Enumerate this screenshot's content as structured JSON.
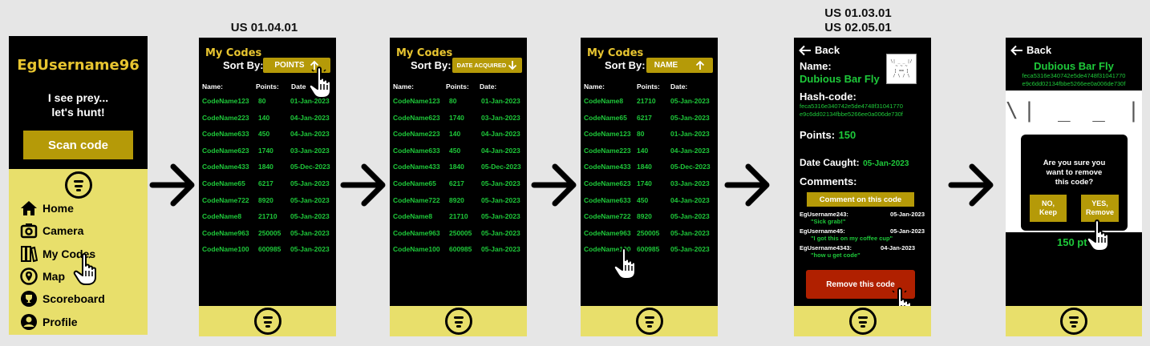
{
  "captions": {
    "screen2": "US 01.04.01",
    "screen5_line1": "US 01.03.01",
    "screen5_line2": "US 02.05.01"
  },
  "home": {
    "username": "EgUsername96",
    "tagline_1": "I see prey...",
    "tagline_2": "let's hunt!",
    "scan_button": "Scan code",
    "menu": [
      {
        "label": "Home",
        "icon": "home-icon"
      },
      {
        "label": "Camera",
        "icon": "camera-icon"
      },
      {
        "label": "My Codes",
        "icon": "codes-icon"
      },
      {
        "label": "Map",
        "icon": "map-pin-icon"
      },
      {
        "label": "Scoreboard",
        "icon": "trophy-icon"
      },
      {
        "label": "Profile",
        "icon": "profile-icon"
      }
    ]
  },
  "mycodes": {
    "title": "My Codes",
    "sort_by": "Sort By:",
    "col_name": "Name:",
    "col_points": "Points:",
    "col_date": "Date:",
    "col_date_partial": "Date",
    "by_points": {
      "sort_label": "POINTS",
      "rows": [
        [
          "CodeName123",
          "80",
          "01-Jan-2023"
        ],
        [
          "CodeName223",
          "140",
          "04-Jan-2023"
        ],
        [
          "CodeName633",
          "450",
          "04-Jan-2023"
        ],
        [
          "CodeName623",
          "1740",
          "03-Jan-2023"
        ],
        [
          "CodeName433",
          "1840",
          "05-Dec-2023"
        ],
        [
          "CodeName65",
          "6217",
          "05-Jan-2023"
        ],
        [
          "CodeName722",
          "8920",
          "05-Jan-2023"
        ],
        [
          "CodeName8",
          "21710",
          "05-Jan-2023"
        ],
        [
          "CodeName963",
          "250005",
          "05-Jan-2023"
        ],
        [
          "CodeName100",
          "600985",
          "05-Jan-2023"
        ]
      ]
    },
    "by_date": {
      "sort_label": "DATE ACQUIRED",
      "rows": [
        [
          "CodeName123",
          "80",
          "01-Jan-2023"
        ],
        [
          "CodeName623",
          "1740",
          "03-Jan-2023"
        ],
        [
          "CodeName223",
          "140",
          "04-Jan-2023"
        ],
        [
          "CodeName633",
          "450",
          "04-Jan-2023"
        ],
        [
          "CodeName433",
          "1840",
          "05-Dec-2023"
        ],
        [
          "CodeName65",
          "6217",
          "05-Jan-2023"
        ],
        [
          "CodeName722",
          "8920",
          "05-Jan-2023"
        ],
        [
          "CodeName8",
          "21710",
          "05-Jan-2023"
        ],
        [
          "CodeName963",
          "250005",
          "05-Jan-2023"
        ],
        [
          "CodeName100",
          "600985",
          "05-Jan-2023"
        ]
      ]
    },
    "by_name": {
      "sort_label": "NAME",
      "rows": [
        [
          "CodeName8",
          "21710",
          "05-Jan-2023"
        ],
        [
          "CodeName65",
          "6217",
          "05-Jan-2023"
        ],
        [
          "CodeName123",
          "80",
          "01-Jan-2023"
        ],
        [
          "CodeName223",
          "140",
          "04-Jan-2023"
        ],
        [
          "CodeName433",
          "1840",
          "05-Dec-2023"
        ],
        [
          "CodeName623",
          "1740",
          "03-Jan-2023"
        ],
        [
          "CodeName633",
          "450",
          "04-Jan-2023"
        ],
        [
          "CodeName722",
          "8920",
          "05-Jan-2023"
        ],
        [
          "CodeName963",
          "250005",
          "05-Jan-2023"
        ],
        [
          "CodeName100",
          "600985",
          "05-Jan-2023"
        ]
      ]
    }
  },
  "detail": {
    "back": "Back",
    "name_label": "Name:",
    "name_value": "Dubious Bar Fly",
    "hash_label": "Hash-code:",
    "hash_1": "feca5316e340742e5de4748f31041770",
    "hash_2": "e9c6dd02134fbbe5266ee0a006de730f",
    "points_label": "Points:",
    "points_value": "150",
    "date_label": "Date Caught:",
    "date_value": "05-Jan-2023",
    "comments_label": "Comments:",
    "comment_button": "Comment on this code",
    "comments": [
      {
        "user": "EgUsername243:",
        "date": "05-Jan-2023",
        "text": "\"Sick grab!\""
      },
      {
        "user": "EgUsername45:",
        "date": "05-Jan-2023",
        "text": "\"I got this on my coffee cup\""
      },
      {
        "user": "EgUsername4343:",
        "date": "04-Jan-2023",
        "text": "\"how u get code\""
      }
    ],
    "remove_button": "Remove this code"
  },
  "confirm": {
    "back": "Back",
    "name": "Dubious Bar Fly",
    "hash_1": "feca5316e340742e5de4748f31041770",
    "hash_2": "e9c6dd02134fbbe5266ee0a006de730f",
    "face_row": "\\| _ _ |/",
    "question_1": "Are you sure you",
    "question_2": "want to remove",
    "question_3": "this code?",
    "no_1": "NO,",
    "no_2": "Keep",
    "yes_1": "YES,",
    "yes_2": "Remove",
    "points_partial": "150 pt"
  },
  "colors": {
    "yellow": "#e8df6b",
    "gold": "#b59a08",
    "green": "#1ec93a",
    "red": "#b02000",
    "title_yellow": "#e8c530"
  }
}
